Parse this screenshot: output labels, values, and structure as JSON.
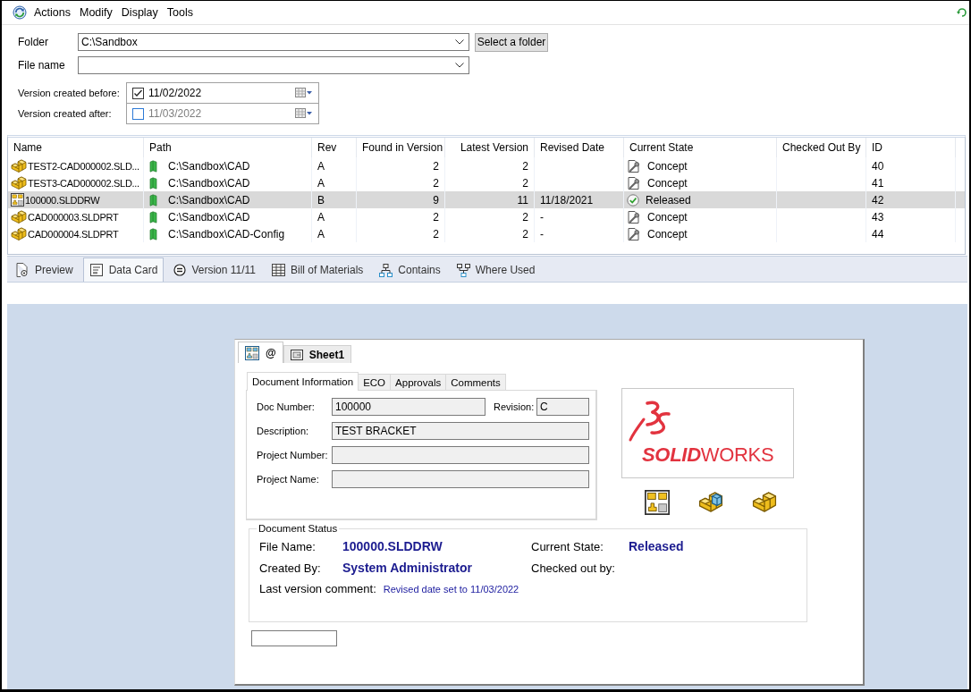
{
  "menu_bar": {
    "items": [
      "Actions",
      "Modify",
      "Display",
      "Tools"
    ]
  },
  "filters": {
    "folder": {
      "label": "Folder",
      "value": "C:\\Sandbox",
      "button": "Select a folder"
    },
    "file_name": {
      "label": "File name"
    },
    "date_filters": [
      {
        "label": "Version created before:",
        "value": "11/02/2022",
        "checked": true
      },
      {
        "label": "Version created after:",
        "value": "11/03/2022",
        "checked": false
      }
    ]
  },
  "table": {
    "columns": [
      "Name",
      "Path",
      "Rev",
      "Found in Version",
      "Latest Version",
      "Revised Date",
      "Current State",
      "Checked Out By",
      "ID"
    ],
    "rows": [
      {
        "kind": "part",
        "name": "TEST2-CAD000002.SLD...",
        "path": "C:\\Sandbox\\CAD",
        "rev": "A",
        "found_in_version": "2",
        "latest_version": "2",
        "state": {
          "kind": "in_progress",
          "label": "Concept"
        },
        "id": "40",
        "selected": false
      },
      {
        "kind": "part",
        "name": "TEST3-CAD000002.SLD...",
        "path": "C:\\Sandbox\\CAD",
        "rev": "A",
        "found_in_version": "2",
        "latest_version": "2",
        "state": {
          "kind": "in_progress",
          "label": "Concept"
        },
        "id": "41",
        "selected": false
      },
      {
        "kind": "drawing",
        "name": "100000.SLDDRW",
        "path": "C:\\Sandbox\\CAD",
        "rev": "B",
        "found_in_version": "9",
        "latest_version": "11",
        "revised_date": "11/18/2021",
        "state": {
          "kind": "released",
          "label": "Released"
        },
        "id": "42",
        "selected": true
      },
      {
        "kind": "part",
        "name": "CAD000003.SLDPRT",
        "path": "C:\\Sandbox\\CAD",
        "rev": "A",
        "found_in_version": "2",
        "latest_version": "2",
        "revised_date": "-",
        "state": {
          "kind": "in_progress",
          "label": "Concept"
        },
        "id": "43",
        "selected": false
      },
      {
        "kind": "part",
        "name": "CAD000004.SLDPRT",
        "path": "C:\\Sandbox\\CAD-Config",
        "rev": "A",
        "found_in_version": "2",
        "latest_version": "2",
        "revised_date": "-",
        "state": {
          "kind": "in_progress",
          "label": "Concept"
        },
        "id": "44",
        "selected": false
      }
    ]
  },
  "detail_tabs": [
    {
      "kind": "preview",
      "label": "Preview",
      "selected": false
    },
    {
      "kind": "data_card",
      "label": "Data Card",
      "selected": true
    },
    {
      "kind": "version",
      "label": "Version 11/11",
      "selected": false
    },
    {
      "kind": "bom",
      "label": "Bill of Materials",
      "selected": false
    },
    {
      "kind": "contains",
      "label": "Contains",
      "selected": false
    },
    {
      "kind": "where_used",
      "label": "Where Used",
      "selected": false
    }
  ],
  "data_card": {
    "sheet_tabs": [
      {
        "kind": "drawing",
        "label": "@",
        "selected": true
      },
      {
        "kind": "sheet",
        "label": "Sheet1",
        "selected": false
      }
    ],
    "info_tabs": [
      {
        "label": "Document Information",
        "selected": true
      },
      {
        "label": "ECO",
        "selected": false
      },
      {
        "label": "Approvals",
        "selected": false
      },
      {
        "label": "Comments",
        "selected": false
      }
    ],
    "doc_number": {
      "label": "Doc Number:",
      "value": "100000"
    },
    "revision": {
      "label": "Revision:",
      "value": "C"
    },
    "description": {
      "label": "Description:",
      "value": "TEST BRACKET"
    },
    "project_number": {
      "label": "Project Number:"
    },
    "project_name": {
      "label": "Project Name:"
    },
    "logo": {
      "text": "**SOLID**WORKS"
    },
    "document_status": {
      "title": "Document Status",
      "file_name": {
        "label": "File Name:",
        "value": "100000.SLDDRW"
      },
      "current_state": {
        "label": "Current State:",
        "value": "Released"
      },
      "created_by": {
        "label": "Created By:",
        "value": "System Administrator"
      },
      "checked_out_by": {
        "label": "Checked out by:"
      },
      "last_version_comment": {
        "label": "Last version comment:",
        "value": "Revised date set to 11/03/2022"
      }
    }
  }
}
